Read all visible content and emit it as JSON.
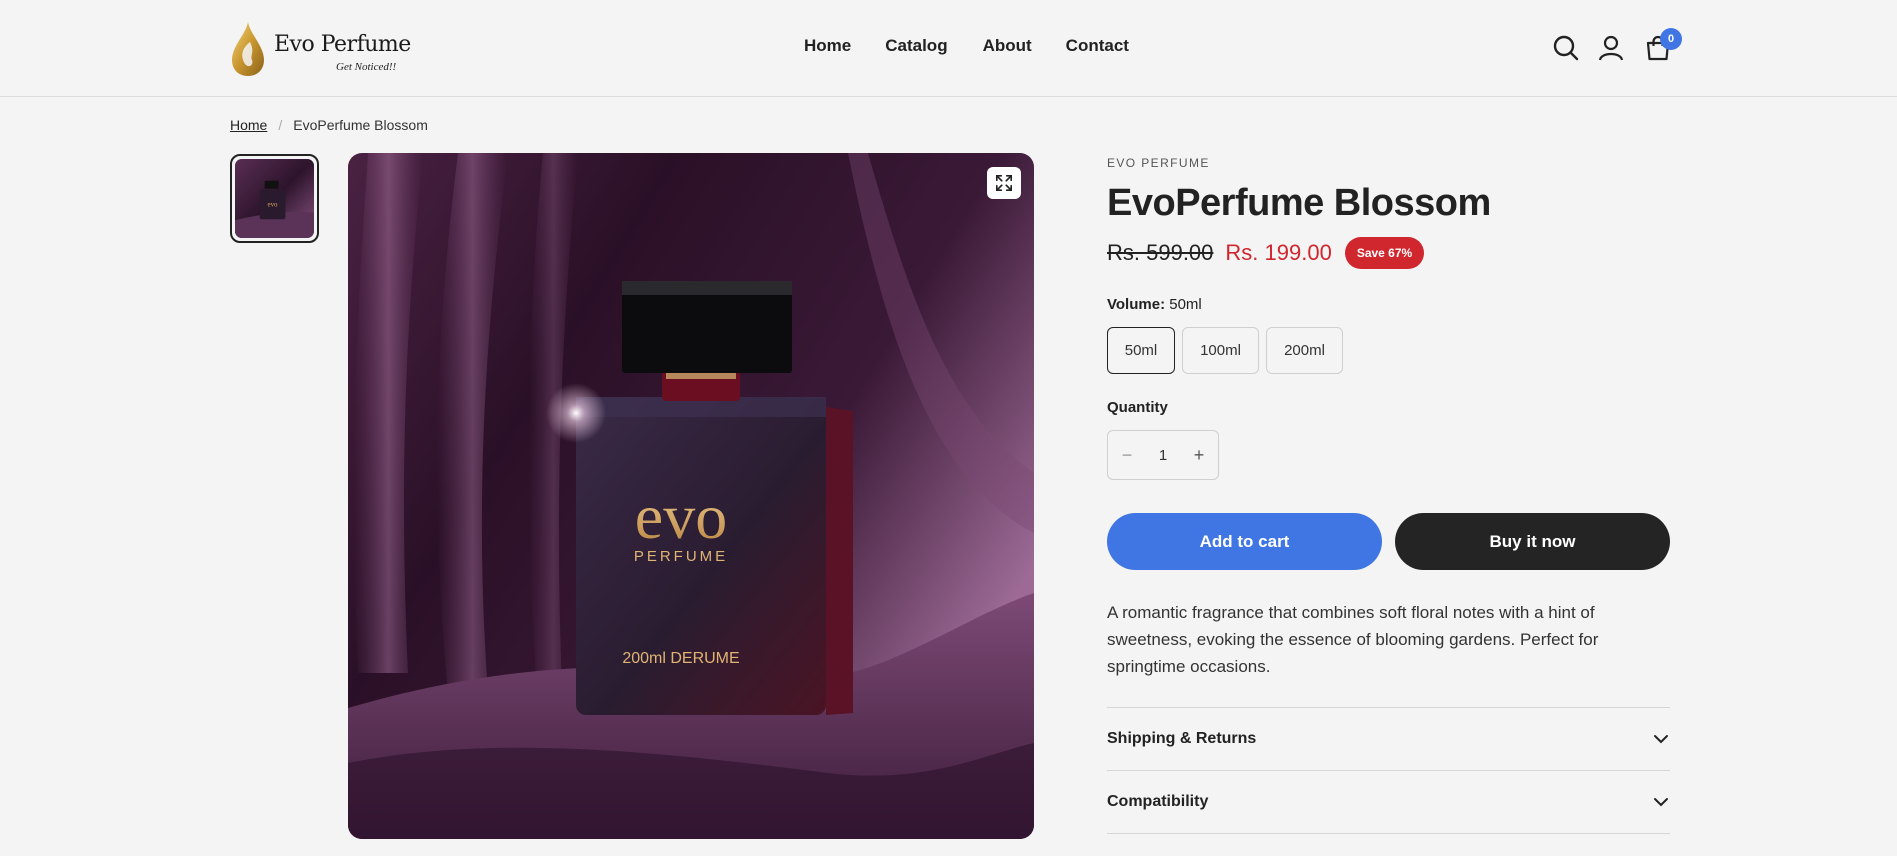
{
  "brand": {
    "name": "Evo Perfume",
    "tagline": "Get Noticed!!",
    "gold": "#d1a640"
  },
  "nav": {
    "items": [
      "Home",
      "Catalog",
      "About",
      "Contact"
    ]
  },
  "header_icons": {
    "search": "search-icon",
    "account": "user-icon",
    "cart": "bag-icon",
    "cart_count": "0"
  },
  "breadcrumb": {
    "home": "Home",
    "separator": "/",
    "current": "EvoPerfume Blossom"
  },
  "gallery": {
    "bottle_brand": "evo",
    "bottle_sub": "PERFUME",
    "bottle_volume": "200ml DERUME"
  },
  "product": {
    "vendor": "EVO PERFUME",
    "title": "EvoPerfume Blossom",
    "price_old": "Rs. 599.00",
    "price_new": "Rs. 199.00",
    "save_badge": "Save 67%",
    "volume_label": "Volume:",
    "volume_selected": "50ml",
    "variants": [
      "50ml",
      "100ml",
      "200ml"
    ],
    "quantity_label": "Quantity",
    "quantity": "1",
    "add_to_cart": "Add to cart",
    "buy_now": "Buy it now",
    "description": "A romantic fragrance that combines soft floral notes with a hint of sweetness, evoking the essence of blooming gardens. Perfect for springtime occasions.",
    "accordions": [
      "Shipping & Returns",
      "Compatibility"
    ]
  },
  "colors": {
    "accent_blue": "#3f76e4",
    "sale_red": "#d0262e",
    "dark_button": "#242424"
  }
}
